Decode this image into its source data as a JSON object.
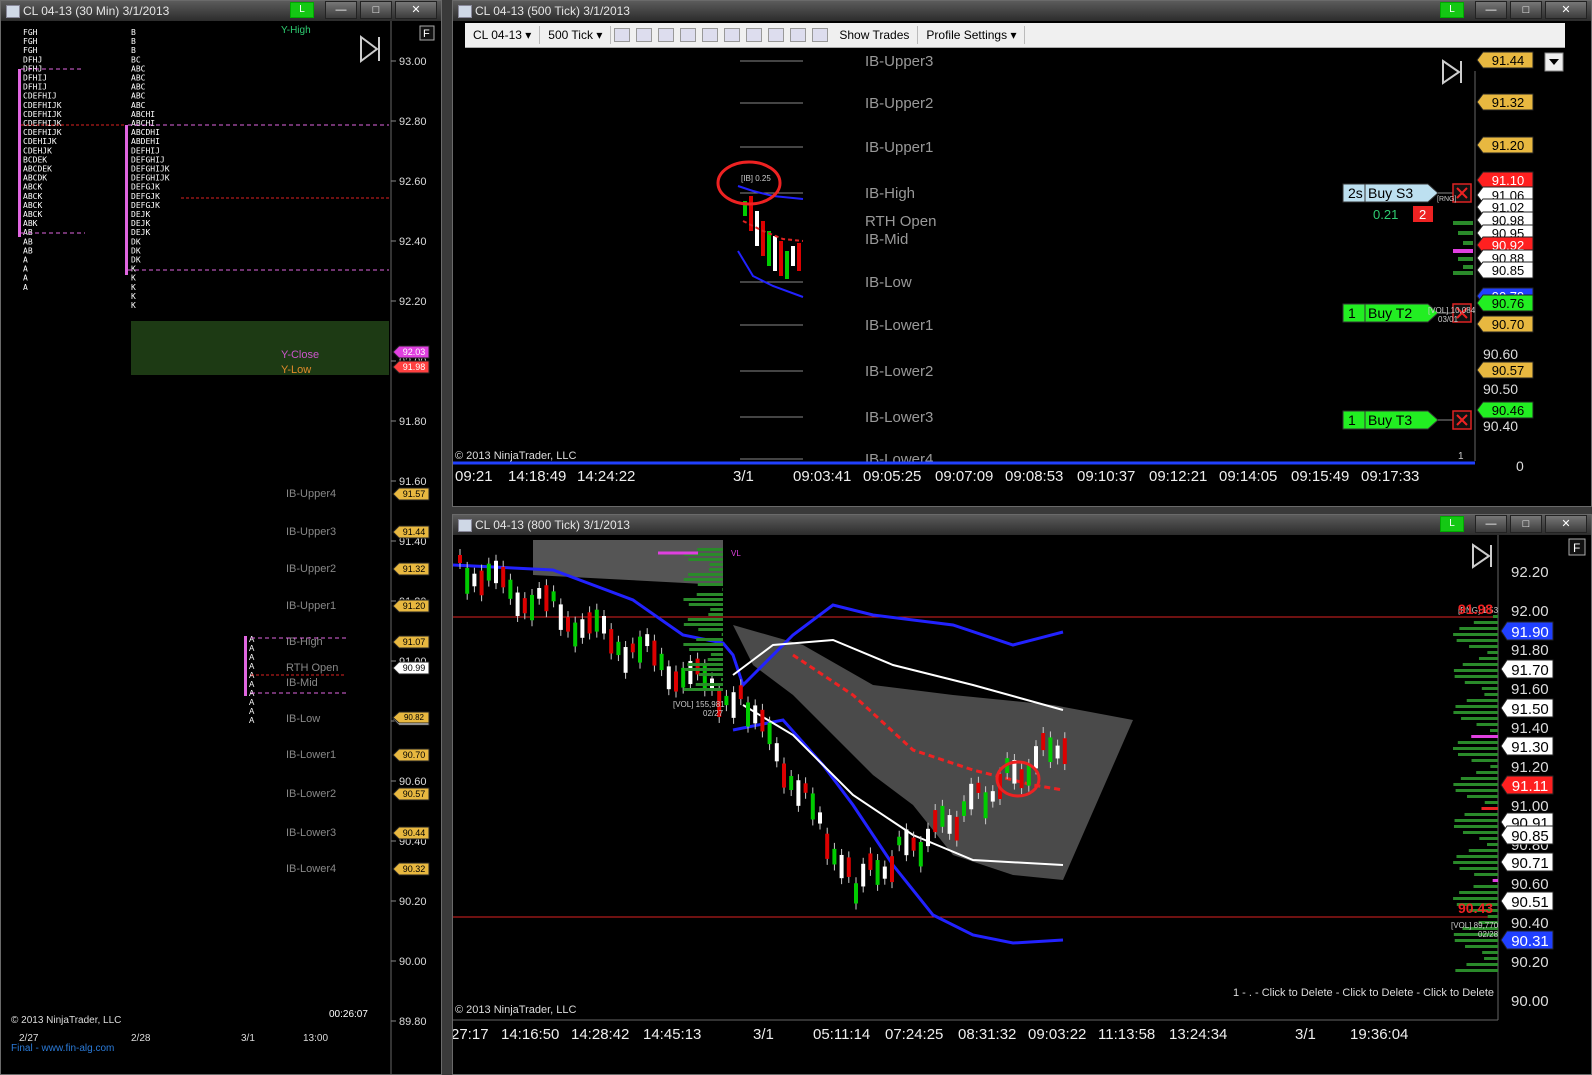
{
  "windows": {
    "left": {
      "title": "CL 04-13 (30 Min)  3/1/2013",
      "badge": "L",
      "btn_min": "—",
      "btn_max": "□",
      "btn_close": "✕"
    },
    "top": {
      "title": "CL 04-13 (500 Tick)  3/1/2013",
      "badge": "L",
      "btn_min": "—",
      "btn_max": "□",
      "btn_close": "✕"
    },
    "bottom": {
      "title": "CL 04-13 (800 Tick)  3/1/2013",
      "badge": "L",
      "btn_min": "—",
      "btn_max": "□",
      "btn_close": "✕"
    }
  },
  "toolbar": {
    "instrument": "CL 04-13",
    "period": "500 Tick",
    "show_trades": "Show Trades",
    "profile_settings": "Profile Settings"
  },
  "left_chart": {
    "price_ticks": [
      "93.00",
      "92.80",
      "92.60",
      "92.40",
      "92.20",
      "92.00",
      "91.80",
      "91.60",
      "91.40",
      "91.20",
      "91.00",
      "90.80",
      "90.60",
      "90.40",
      "90.20",
      "90.00",
      "89.80"
    ],
    "date_labels": [
      "2/27",
      "2/28",
      "3/1",
      "13:00"
    ],
    "copyright": "© 2013 NinjaTrader, LLC",
    "watermark": "Final - www.fin-alg.com",
    "timer": "00:26:07",
    "f_button": "F",
    "top_label": "Y-High",
    "y_close": "Y-Close",
    "y_low": "Y-Low",
    "y_close_price": "92.03",
    "y_low_price": "91.98",
    "ib_levels": [
      {
        "name": "IB-Upper4",
        "price": "91.57"
      },
      {
        "name": "IB-Upper3",
        "price": "91.44"
      },
      {
        "name": "IB-Upper2",
        "price": "91.32"
      },
      {
        "name": "IB-Upper1",
        "price": "91.20"
      },
      {
        "name": "IB-High",
        "price": "91.07"
      },
      {
        "name": "RTH Open",
        "price": "90.99"
      },
      {
        "name": "IB-Mid",
        "price": ""
      },
      {
        "name": "IB-Low",
        "price": "90.85"
      },
      {
        "name": "IB-Lower1",
        "price": "90.70"
      },
      {
        "name": "IB-Lower2",
        "price": "90.57"
      },
      {
        "name": "IB-Lower3",
        "price": "90.44"
      },
      {
        "name": "IB-Lower4",
        "price": "90.32"
      }
    ],
    "ib_low_extra": "90.82",
    "tpo_col1": [
      "FGH",
      "FGH",
      "FGH",
      "DFHJ",
      "DFHJ",
      "DFHIJ",
      "DFHIJ",
      "CDEFHIJ",
      "CDEFHIJK",
      "CDEFHIJK",
      "CDEFHIJK",
      "CDEFHIJK",
      "CDEHIJK",
      "CDEHJK",
      "BCDEK",
      "ABCDEK",
      "ABCDK",
      "ABCK",
      "ABCK",
      "ABCK",
      "ABCK",
      "ABK",
      "AB",
      "AB",
      "AB",
      "A",
      "A",
      "A",
      "A"
    ],
    "tpo_col2": [
      "B",
      "B",
      "B",
      "BC",
      "ABC",
      "ABC",
      "ABC",
      "ABC",
      "ABC",
      "ABCHI",
      "ABCHI",
      "ABCDHI",
      "ABDEHI",
      "DEFHIJ",
      "DEFGHIJ",
      "DEFGHIJK",
      "DEFGHIJK",
      "DEFGJK",
      "DEFGJK",
      "DEFGJK",
      "DEJK",
      "DEJK",
      "DEJK",
      "DK",
      "DK",
      "DK",
      "K",
      "K",
      "K",
      "K",
      "K"
    ]
  },
  "top_chart": {
    "ib_levels": [
      "IB-Upper3",
      "IB-Upper2",
      "IB-Upper1",
      "IB-High",
      "RTH Open",
      "IB-Mid",
      "IB-Low",
      "IB-Lower1",
      "IB-Lower2",
      "IB-Lower3",
      "IB-Lower4"
    ],
    "price_tags": [
      "91.44",
      "91.32",
      "91.20",
      "91.10",
      "91.06",
      "91.02",
      "90.98",
      "90.95",
      "90.92",
      "90.88",
      "90.85",
      "90.79",
      "90.76",
      "90.70",
      "90.57",
      "90.46"
    ],
    "axis_ticks": [
      "90.60",
      "90.50",
      "90.40"
    ],
    "time_ticks": [
      "09:21",
      "14:18:49",
      "14:24:22",
      "3/1",
      "09:03:41",
      "09:05:25",
      "09:07:09",
      "09:08:53",
      "09:10:37",
      "09:12:21",
      "09:14:05",
      "09:15:49",
      "09:17:33"
    ],
    "zero_label": "0",
    "copyright": "© 2013 NinjaTrader, LLC",
    "ib_tag": "[IB] 0.25",
    "vol_tag": "[VOL] 10,084",
    "vol_date": "03/01",
    "rng_tag": "[RNG]",
    "orders": [
      {
        "qty": "2s",
        "label": "Buy S3",
        "color": "#bde0f0"
      },
      {
        "qty": "1",
        "label": "Buy T2",
        "color": "#22ee22"
      },
      {
        "qty": "1",
        "label": "Buy T3",
        "color": "#22ee22"
      }
    ],
    "order_s3_pnl": "0.21",
    "order_s3_count": "2",
    "misc_one": "1",
    "dropdown_icon": "chevron-down"
  },
  "bottom_chart": {
    "axis_ticks": [
      "92.20",
      "92.00",
      "91.80",
      "91.60",
      "91.40",
      "91.20",
      "91.00",
      "90.80",
      "90.60",
      "90.40",
      "90.20",
      "90.00"
    ],
    "price_tags": [
      "91.90",
      "91.70",
      "91.50",
      "91.30",
      "91.11",
      "90.91",
      "90.85",
      "90.71",
      "90.51",
      "90.31"
    ],
    "red_price_high": "91.98",
    "red_price_low": "90.43",
    "time_ticks": [
      "27:17",
      "14:16:50",
      "14:28:42",
      "14:45:13",
      "3/1",
      "05:11:14",
      "07:24:25",
      "08:31:32",
      "09:03:22",
      "11:13:58",
      "13:24:34",
      "3/1",
      "19:36:04"
    ],
    "copyright": "© 2013 NinjaTrader, LLC",
    "delete_hint": "1 - . - Click to Delete - Click to Delete - Click to Delete",
    "vol_tag": "[VOL] 155,981",
    "vol_date": "02/27",
    "vol_tag2": "[VOL] 89,770",
    "vol_date2": "02/28",
    "rng_tag": "[RNG] 1.53",
    "f_button": "F",
    "vl_label": "VL"
  }
}
